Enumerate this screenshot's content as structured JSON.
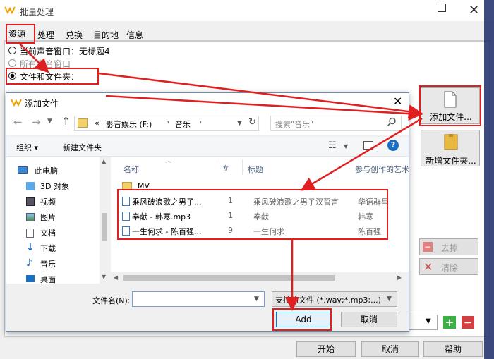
{
  "main_window": {
    "title": "批量处理",
    "tabs": [
      "资源",
      "处理",
      "兑换",
      "目的地",
      "信息"
    ],
    "radio_current": "当前声音窗口：无标题4",
    "radio_all": "所有声音窗口",
    "radio_files": "文件和文件夹：",
    "add_file_button": "添加文件...",
    "new_folder_button": "新增文件夹...",
    "remove_button": "去掉",
    "clear_button": "清除",
    "start_button": "开始",
    "cancel_button": "取消",
    "help_button": "帮助"
  },
  "dialog": {
    "title": "添加文件",
    "breadcrumb": [
      "«",
      "影音娱乐 (F:)",
      "音乐"
    ],
    "search_placeholder": "搜索\"音乐\"",
    "organize": "组织 ▾",
    "new_folder": "新建文件夹",
    "columns": [
      "名称",
      "#",
      "标题",
      "参与创作的艺术"
    ],
    "nav": [
      "此电脑",
      "3D 对象",
      "视频",
      "图片",
      "文档",
      "下载",
      "音乐",
      "桌面"
    ],
    "files": [
      {
        "name": "MV",
        "num": "",
        "title": "",
        "artist": "",
        "folder": true
      },
      {
        "name": "乘风破浪歌之男子...",
        "num": "1",
        "title": "乘风破浪歌之男子汉誓言",
        "artist": "华语群星",
        "folder": false
      },
      {
        "name": "奉献 - 韩寒.mp3",
        "num": "1",
        "title": "奉献",
        "artist": "韩寒",
        "folder": false
      },
      {
        "name": "一生何求 - 陈百强...",
        "num": "9",
        "title": "一生何求",
        "artist": "陈百强",
        "folder": false
      }
    ],
    "filename_label": "文件名(N):",
    "filename_value": "",
    "filetype": "支持的文件 (*.wav;*.mp3;...)",
    "add_button": "Add",
    "cancel_button": "取消"
  }
}
